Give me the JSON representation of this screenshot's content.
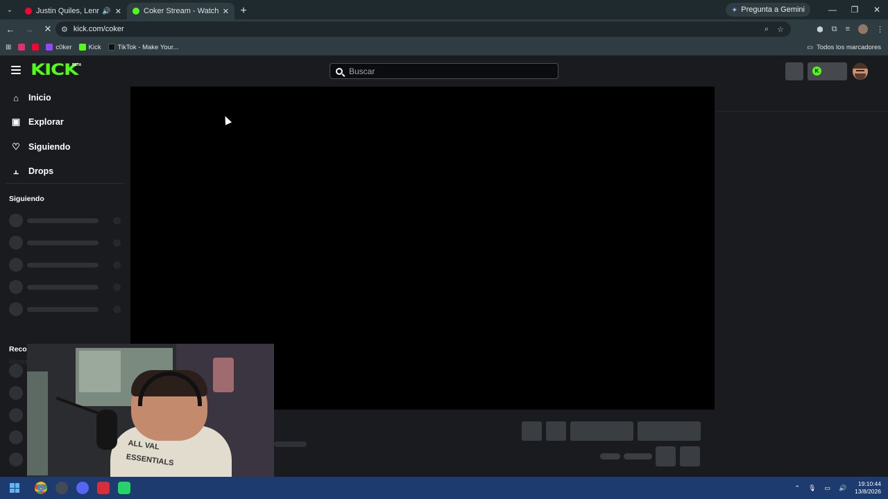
{
  "browser": {
    "tabs": [
      {
        "title": "Justin Quiles, Lenny Tavárez",
        "active": false,
        "favicon_color": "#ff0033"
      },
      {
        "title": "Coker Stream - Watch Live on K",
        "active": true,
        "favicon_color": "#53fc18"
      }
    ],
    "gemini_label": "Pregunta a Gemini",
    "url": "kick.com/coker",
    "bookmarks": [
      {
        "label": "",
        "icon": "instagram-icon",
        "color": "#e1306c"
      },
      {
        "label": "",
        "icon": "youtube-icon",
        "color": "#ff0033"
      },
      {
        "label": "c0ker",
        "icon": "twitch-icon",
        "color": "#9146ff"
      },
      {
        "label": "Kick",
        "icon": "kick-icon",
        "color": "#53fc18"
      },
      {
        "label": "TikTok - Make Your...",
        "icon": "tiktok-icon",
        "color": "#000000"
      }
    ],
    "all_bookmarks_label": "Todos los marcadores"
  },
  "kick": {
    "brand": "KICK",
    "beta": "BETA",
    "brand_color": "#53fc18",
    "search_placeholder": "Buscar",
    "nav": [
      {
        "label": "Inicio",
        "icon": "home-icon"
      },
      {
        "label": "Explorar",
        "icon": "explore-icon"
      },
      {
        "label": "Siguiendo",
        "icon": "heart-icon"
      },
      {
        "label": "Drops",
        "icon": "drops-icon"
      }
    ],
    "following_heading": "Siguiendo",
    "show_more": "Mostrar más",
    "recommended_heading": "Reco"
  },
  "webcam": {
    "shirt_text_line1": "ALL VAL",
    "shirt_text_line2": "ESSENTIALS"
  },
  "taskbar": {
    "time": "19:10:44",
    "date": "13/8/2026"
  }
}
